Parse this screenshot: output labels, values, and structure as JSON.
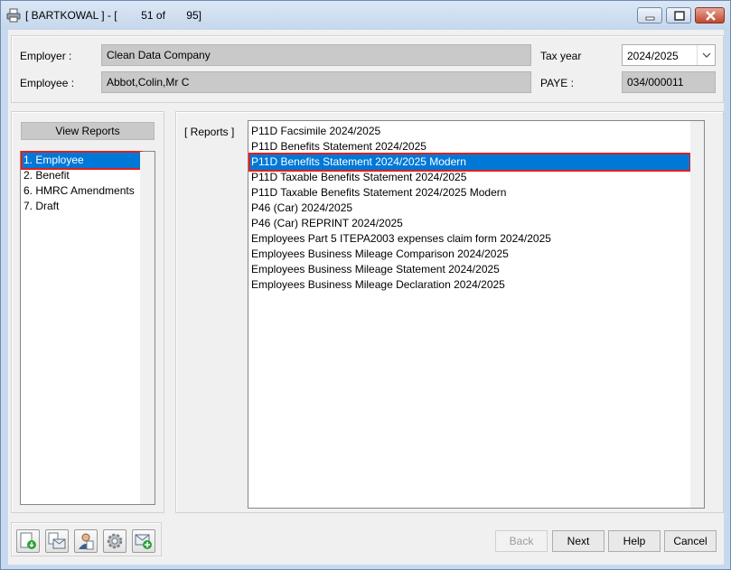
{
  "window": {
    "title": "[ BARTKOWAL ] - [        51 of       95]",
    "controls": [
      "minimize",
      "maximize",
      "close"
    ]
  },
  "header": {
    "employer_label": "Employer :",
    "employer_value": "Clean Data Company",
    "employee_label": "Employee :",
    "employee_value": "Abbot,Colin,Mr C",
    "tax_year_label": "Tax year",
    "tax_year_value": "2024/2025",
    "paye_label": "PAYE :",
    "paye_value": "034/000011"
  },
  "left": {
    "view_reports_label": "View Reports",
    "categories": [
      "1. Employee",
      "2. Benefit",
      "6. HMRC Amendments",
      "7. Draft"
    ],
    "selected_index": 0
  },
  "reports": {
    "label": "[ Reports ]",
    "items": [
      "P11D Facsimile 2024/2025",
      "P11D Benefits Statement 2024/2025",
      "P11D Benefits Statement 2024/2025 Modern",
      "P11D Taxable Benefits Statement 2024/2025",
      "P11D Taxable Benefits Statement 2024/2025 Modern",
      "P46 (Car) 2024/2025",
      "P46 (Car) REPRINT 2024/2025",
      "Employees Part 5 ITEPA2003 expenses claim form 2024/2025",
      "Employees Business Mileage Comparison 2024/2025",
      "Employees Business Mileage Statement 2024/2025",
      "Employees Business Mileage Declaration 2024/2025"
    ],
    "selected_index": 2
  },
  "toolbar": {
    "icons": [
      "export-document-icon",
      "email-document-icon",
      "employee-icon",
      "settings-gear-icon",
      "add-email-icon"
    ]
  },
  "buttons": {
    "back": "Back",
    "next": "Next",
    "help": "Help",
    "cancel": "Cancel"
  },
  "colors": {
    "selection": "#0078d7",
    "highlight_outline": "#e0201b",
    "readonly_field": "#c9c9c9"
  }
}
